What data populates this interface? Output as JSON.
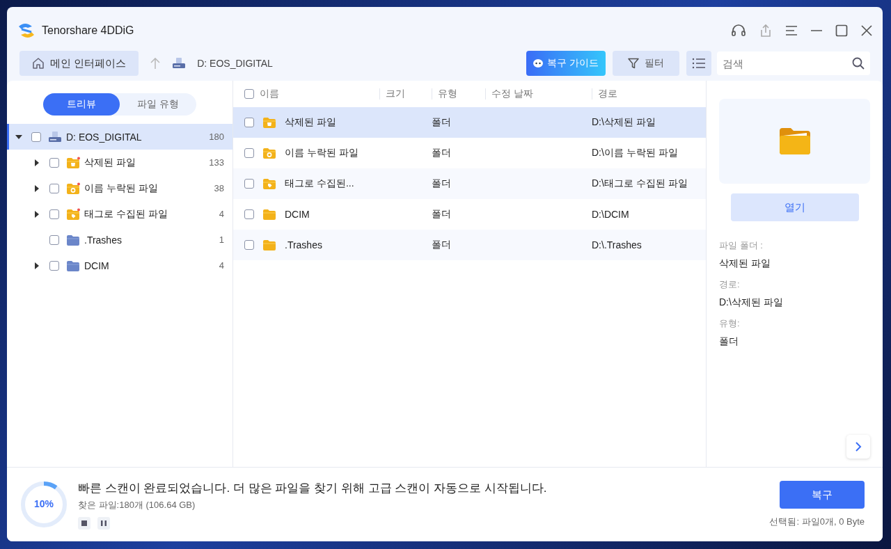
{
  "window": {
    "title": "Tenorshare 4DDiG"
  },
  "toolbar": {
    "home": "메인 인터페이스",
    "location": "D: EOS_DIGITAL",
    "guide": "복구 가이드",
    "filter": "필터",
    "search": {
      "placeholder": "검색"
    }
  },
  "view_tabs": [
    {
      "label": "트리뷰",
      "selected": true
    },
    {
      "label": "파일 유형",
      "selected": false
    }
  ],
  "tree": [
    {
      "label": "D: EOS_DIGITAL",
      "count": "180",
      "kind": "drive",
      "checked": false,
      "selected": true,
      "expandable": true,
      "expanded": true,
      "children": [
        {
          "label": "삭제된 파일",
          "count": "133",
          "kind": "deleted",
          "checked": false,
          "selected": false,
          "expandable": true,
          "expanded": false
        },
        {
          "label": "이름 누락된 파일",
          "count": "38",
          "kind": "unnamed",
          "checked": false,
          "selected": false,
          "expandable": true,
          "expanded": false
        },
        {
          "label": "태그로 수집된 파일",
          "count": "4",
          "kind": "tagged",
          "checked": false,
          "selected": false,
          "expandable": true,
          "expanded": false
        },
        {
          "label": ".Trashes",
          "count": "1",
          "kind": "folder",
          "checked": false,
          "selected": false,
          "expandable": false
        },
        {
          "label": "DCIM",
          "count": "4",
          "kind": "folder",
          "checked": false,
          "selected": false,
          "expandable": true,
          "expanded": false
        }
      ]
    }
  ],
  "table": {
    "all_checked": false,
    "columns": [
      "이름",
      "크기",
      "유형",
      "수정 날짜",
      "경로"
    ],
    "rows": [
      {
        "name": "삭제된 파일",
        "type": "폴더",
        "path": "D:\\삭제된 파일",
        "kind": "deleted",
        "checked": false,
        "selected": true
      },
      {
        "name": "이름 누락된 파일",
        "type": "폴더",
        "path": "D:\\이름 누락된 파일",
        "kind": "unnamed",
        "checked": false,
        "selected": false
      },
      {
        "name": "태그로 수집된...",
        "type": "폴더",
        "path": "D:\\태그로 수집된 파일",
        "kind": "tagged",
        "checked": false,
        "selected": false
      },
      {
        "name": "DCIM",
        "type": "폴더",
        "path": "D:\\DCIM",
        "kind": "folder",
        "checked": false,
        "selected": false
      },
      {
        "name": ".Trashes",
        "type": "폴더",
        "path": "D:\\.Trashes",
        "kind": "folder",
        "checked": false,
        "selected": false
      }
    ]
  },
  "details": {
    "open_button": "열기",
    "fields": [
      {
        "label": "파일 폴더 :",
        "value": "삭제된 파일"
      },
      {
        "label": "경로:",
        "value": "D:\\삭제된 파일"
      },
      {
        "label": "유형:",
        "value": "폴더"
      }
    ]
  },
  "status": {
    "progress": {
      "level": 0.1,
      "reading": "10%"
    },
    "message": "빠른 스캔이 완료되었습니다. 더 많은 파일을 찾기 위해 고급 스캔이 자동으로 시작됩니다.",
    "found": "찾은 파일:180개 (106.64 GB)",
    "recover_button": "복구",
    "selection": "선택됨: 파일0개, 0 Byte"
  }
}
